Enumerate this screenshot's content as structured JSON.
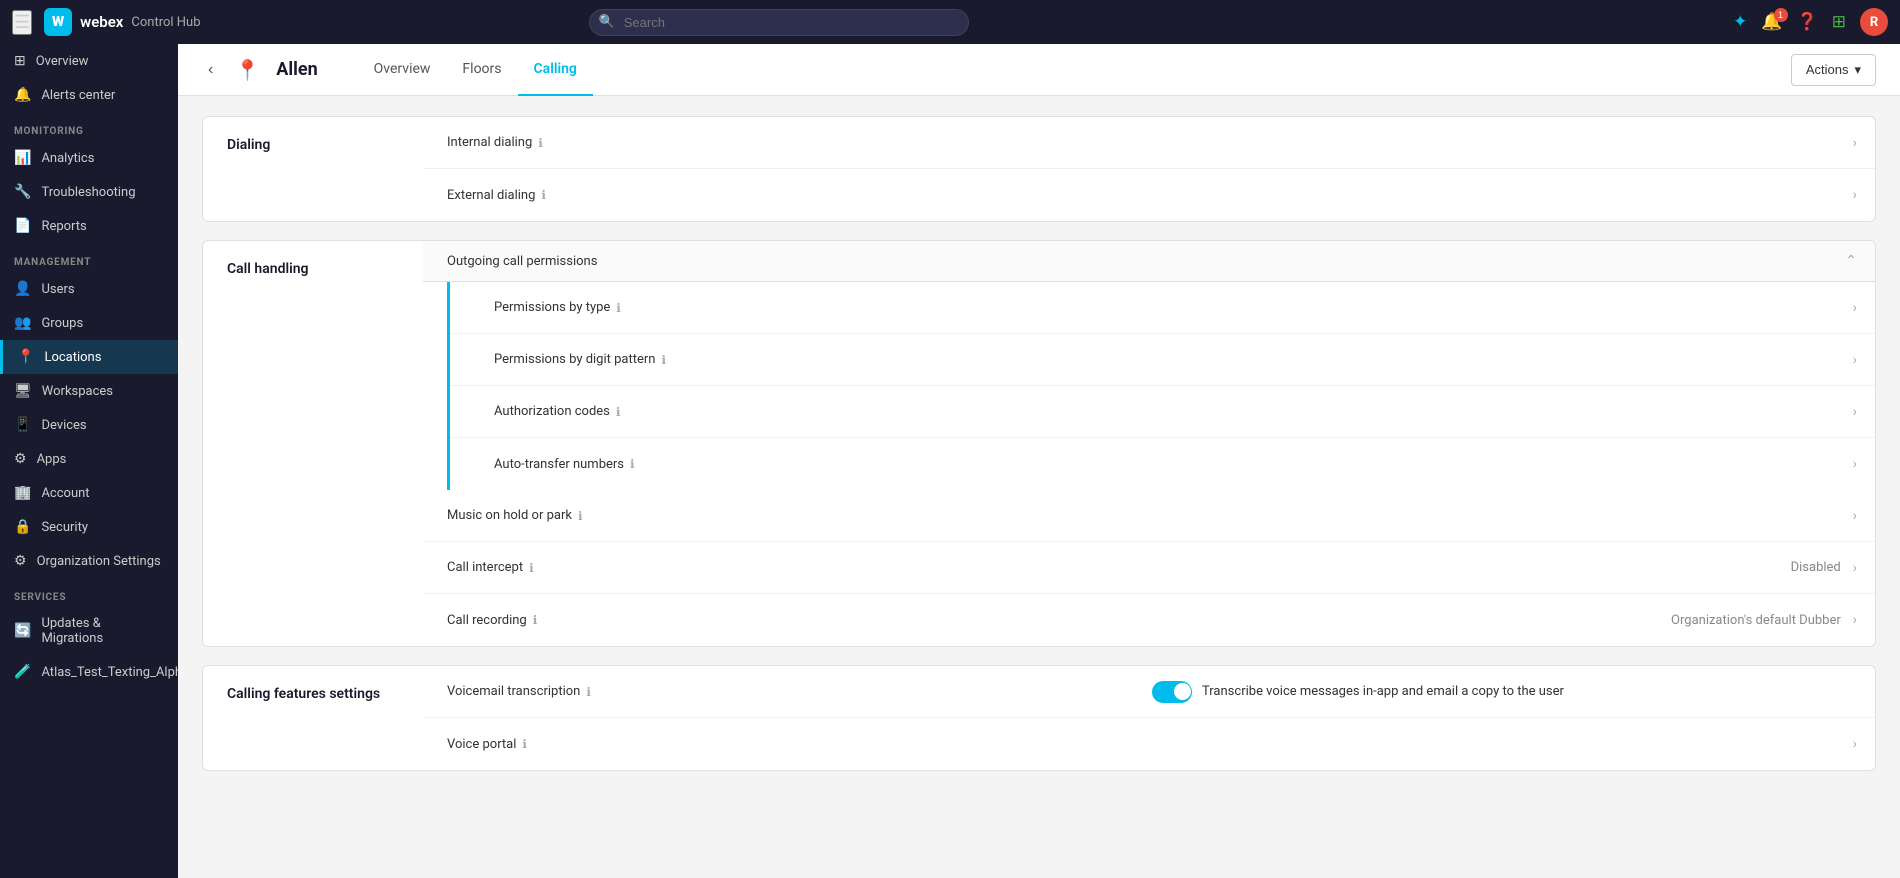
{
  "topnav": {
    "brand": "webex",
    "product": "Control Hub",
    "search_placeholder": "Search",
    "notification_count": "1",
    "avatar_initials": "R"
  },
  "sidebar": {
    "monitoring_label": "MONITORING",
    "management_label": "MANAGEMENT",
    "services_label": "SERVICES",
    "items": [
      {
        "id": "overview",
        "label": "Overview",
        "icon": "⊞"
      },
      {
        "id": "alerts",
        "label": "Alerts center",
        "icon": "🔔"
      },
      {
        "id": "analytics",
        "label": "Analytics",
        "icon": "📊"
      },
      {
        "id": "troubleshooting",
        "label": "Troubleshooting",
        "icon": "🔧"
      },
      {
        "id": "reports",
        "label": "Reports",
        "icon": "📄"
      },
      {
        "id": "users",
        "label": "Users",
        "icon": "👤"
      },
      {
        "id": "groups",
        "label": "Groups",
        "icon": "👥"
      },
      {
        "id": "locations",
        "label": "Locations",
        "icon": "📍",
        "active": true
      },
      {
        "id": "workspaces",
        "label": "Workspaces",
        "icon": "🖥"
      },
      {
        "id": "devices",
        "label": "Devices",
        "icon": "📱"
      },
      {
        "id": "apps",
        "label": "Apps",
        "icon": "⚙"
      },
      {
        "id": "account",
        "label": "Account",
        "icon": "🏢"
      },
      {
        "id": "security",
        "label": "Security",
        "icon": "🔒"
      },
      {
        "id": "org-settings",
        "label": "Organization Settings",
        "icon": "⚙"
      },
      {
        "id": "updates",
        "label": "Updates & Migrations",
        "icon": "🔄"
      },
      {
        "id": "atlas-test",
        "label": "Atlas_Test_Texting_Alpha",
        "icon": "🧪"
      }
    ]
  },
  "page": {
    "location_icon": "📍",
    "title": "Allen",
    "tabs": [
      {
        "id": "overview",
        "label": "Overview"
      },
      {
        "id": "floors",
        "label": "Floors"
      },
      {
        "id": "calling",
        "label": "Calling",
        "active": true
      }
    ],
    "actions_label": "Actions"
  },
  "dialing_section": {
    "title": "Dialing",
    "rows": [
      {
        "id": "internal-dialing",
        "label": "Internal dialing",
        "has_info": true
      },
      {
        "id": "external-dialing",
        "label": "External dialing",
        "has_info": true
      }
    ]
  },
  "call_handling_section": {
    "title": "Call handling",
    "outgoing_label": "Outgoing call permissions",
    "sub_rows": [
      {
        "id": "permissions-type",
        "label": "Permissions by type",
        "has_info": true
      },
      {
        "id": "permissions-digit",
        "label": "Permissions by digit pattern",
        "has_info": true
      },
      {
        "id": "auth-codes",
        "label": "Authorization codes",
        "has_info": true
      },
      {
        "id": "auto-transfer",
        "label": "Auto-transfer numbers",
        "has_info": true
      }
    ],
    "other_rows": [
      {
        "id": "music-hold",
        "label": "Music on hold or park",
        "has_info": true,
        "value": ""
      },
      {
        "id": "call-intercept",
        "label": "Call intercept",
        "has_info": true,
        "value": "Disabled"
      },
      {
        "id": "call-recording",
        "label": "Call recording",
        "has_info": true,
        "value": "Organization's default Dubber"
      }
    ]
  },
  "calling_features_section": {
    "title": "Calling features settings",
    "rows": [
      {
        "id": "voicemail-transcription",
        "label": "Voicemail transcription",
        "has_info": true,
        "has_toggle": true,
        "toggle_on": true,
        "toggle_label": "Transcribe voice messages in-app and email a copy to the user"
      },
      {
        "id": "voice-portal",
        "label": "Voice portal",
        "has_info": true,
        "has_toggle": false,
        "value": ""
      }
    ]
  }
}
